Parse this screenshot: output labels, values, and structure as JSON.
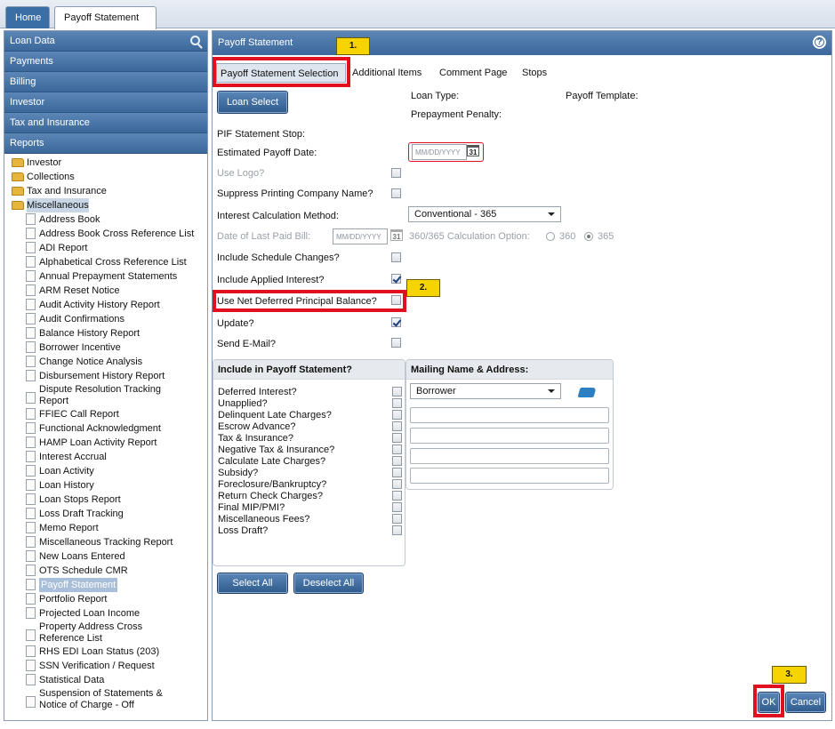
{
  "top_tabs": {
    "home": "Home",
    "payoff": "Payoff Statement"
  },
  "left": {
    "sections": [
      "Loan Data",
      "Payments",
      "Billing",
      "Investor",
      "Tax and Insurance",
      "Reports"
    ],
    "folders": [
      "Investor",
      "Collections",
      "Tax and Insurance",
      "Miscellaneous"
    ],
    "items": [
      "Address Book",
      "Address Book Cross Reference List",
      "ADI Report",
      "Alphabetical Cross Reference List",
      "Annual Prepayment Statements",
      "ARM Reset Notice",
      "Audit Activity History Report",
      "Audit Confirmations",
      "Balance History Report",
      "Borrower Incentive",
      "Change Notice Analysis",
      "Disbursement History Report",
      "Dispute Resolution Tracking Report",
      "FFIEC Call Report",
      "Functional Acknowledgment",
      "HAMP Loan Activity Report",
      "Interest Accrual",
      "Loan Activity",
      "Loan History",
      "Loan Stops Report",
      "Loss Draft Tracking",
      "Memo Report",
      "Miscellaneous Tracking Report",
      "New Loans Entered",
      "OTS Schedule CMR",
      "Payoff Statement",
      "Portfolio Report",
      "Projected Loan Income",
      "Property Address Cross Reference List",
      "RHS EDI Loan Status (203)",
      "SSN Verification / Request",
      "Statistical Data",
      "Suspension of Statements & Notice of Charge - Off"
    ]
  },
  "main": {
    "title": "Payoff Statement",
    "help": "?",
    "tabs": [
      "Payoff Statement Selection",
      "Additional Items",
      "Comment Page",
      "Stops"
    ],
    "callouts": [
      "1.",
      "2.",
      "3."
    ],
    "loan_select": "Loan Select",
    "loan_type": "Loan Type:",
    "payoff_template": "Payoff Template:",
    "prepayment_penalty": "Prepayment Penalty:",
    "pif_stop": "PIF Statement Stop:",
    "est_payoff_date": "Estimated Payoff Date:",
    "date_placeholder": "MM/DD/YYYY",
    "cal": "31",
    "use_logo": "Use Logo?",
    "suppress": "Suppress Printing Company Name?",
    "interest_method": "Interest Calculation Method:",
    "interest_method_value": "Conventional - 365",
    "last_paid": "Date of Last Paid Bill:",
    "calc_option": "360/365 Calculation Option:",
    "opt360": "360",
    "opt365": "365",
    "schedule_changes": "Include Schedule Changes?",
    "applied_interest": "Include Applied Interest?",
    "net_deferred": "Use Net Deferred Principal Balance?",
    "update": "Update?",
    "send_email": "Send E-Mail?",
    "include_header": "Include in Payoff Statement?",
    "include_items": [
      "Deferred Interest?",
      "Unapplied?",
      "Delinquent Late Charges?",
      "Escrow Advance?",
      "Tax & Insurance?",
      "Negative Tax & Insurance?",
      "Calculate Late Charges?",
      "Subsidy?",
      "Foreclosure/Bankruptcy?",
      "Return Check Charges?",
      "Final MIP/PMI?",
      "Miscellaneous Fees?",
      "Loss Draft?"
    ],
    "mailing_header": "Mailing Name & Address:",
    "mailing_select": "Borrower",
    "select_all": "Select All",
    "deselect_all": "Deselect All",
    "ok": "OK",
    "cancel": "Cancel"
  }
}
